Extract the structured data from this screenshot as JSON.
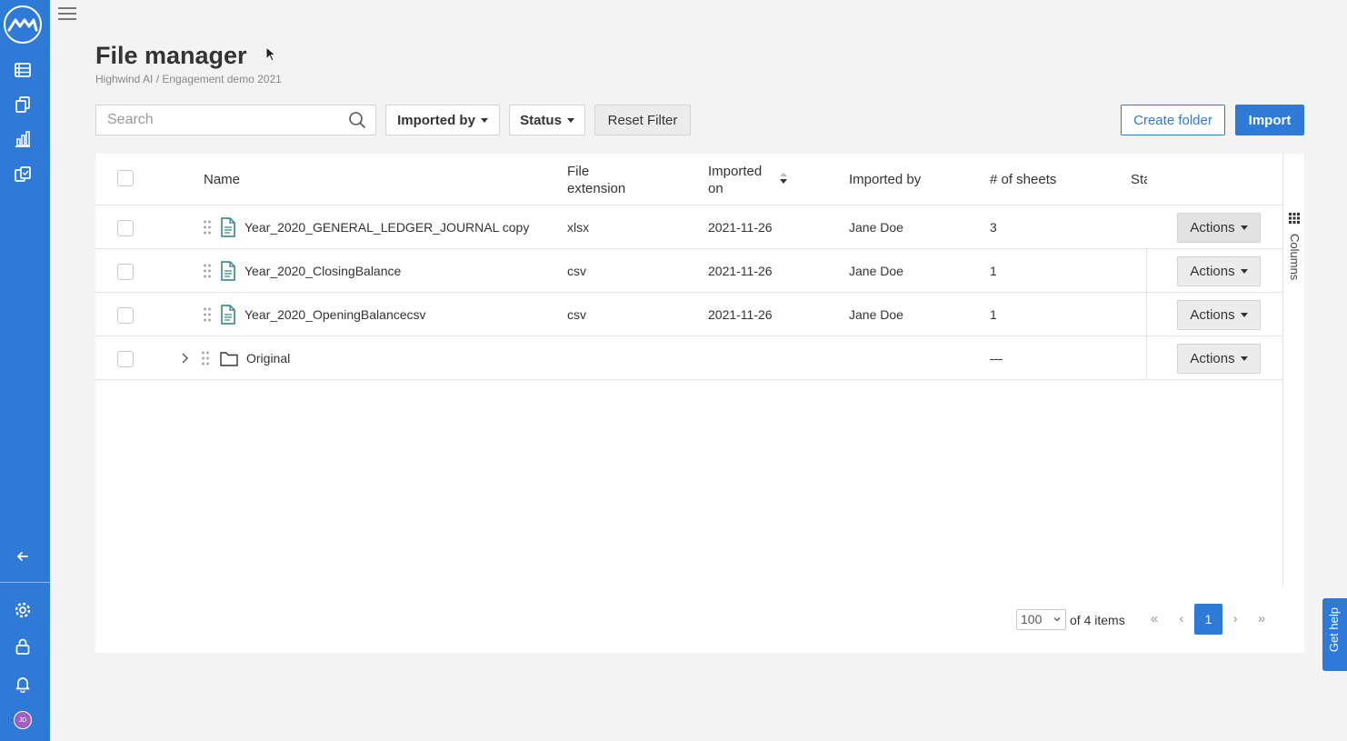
{
  "nav": {
    "logo": "logo-icon",
    "items": [
      "grid-table-icon",
      "documents-icon",
      "bar-chart-icon",
      "checklist-icon"
    ],
    "collapse": "arrow-left-icon",
    "bottom": [
      "settings-icon",
      "lock-icon",
      "bell-icon"
    ],
    "avatar_initials": "JD"
  },
  "header": {
    "title": "File manager",
    "breadcrumb": "Highwind AI / Engagement demo 2021"
  },
  "toolbar": {
    "search_placeholder": "Search",
    "imported_by_label": "Imported by",
    "status_label": "Status",
    "reset_label": "Reset Filter",
    "create_folder_label": "Create folder",
    "import_label": "Import"
  },
  "table": {
    "columns": {
      "name": "Name",
      "ext_line1": "File",
      "ext_line2": "extension",
      "imported_on_line1": "Imported",
      "imported_on_line2": "on",
      "imported_by": "Imported by",
      "sheets": "# of sheets",
      "status": "Sta"
    },
    "rows": [
      {
        "name": "Year_2020_GENERAL_LEDGER_JOURNAL copy",
        "ext": "xlsx",
        "date": "2021-11-26",
        "by": "Jane Doe",
        "sheets": "3",
        "actions": "Actions"
      },
      {
        "name": "Year_2020_ClosingBalance",
        "ext": "csv",
        "date": "2021-11-26",
        "by": "Jane Doe",
        "sheets": "1",
        "actions": "Actions"
      },
      {
        "name": "Year_2020_OpeningBalancecsv",
        "ext": "csv",
        "date": "2021-11-26",
        "by": "Jane Doe",
        "sheets": "1",
        "actions": "Actions"
      },
      {
        "name": "Original",
        "ext": "",
        "date": "",
        "by": "",
        "sheets": "—",
        "actions": "Actions"
      }
    ],
    "columns_panel_label": "Columns"
  },
  "pagination": {
    "page_size": "100",
    "total_text": "of 4 items",
    "current_page": "1",
    "first": "«",
    "prev": "‹",
    "next": "›",
    "last": "»"
  },
  "help": {
    "label": "Get help"
  },
  "colors": {
    "accent": "#2e7ad6",
    "avatar": "#a35fbf"
  }
}
